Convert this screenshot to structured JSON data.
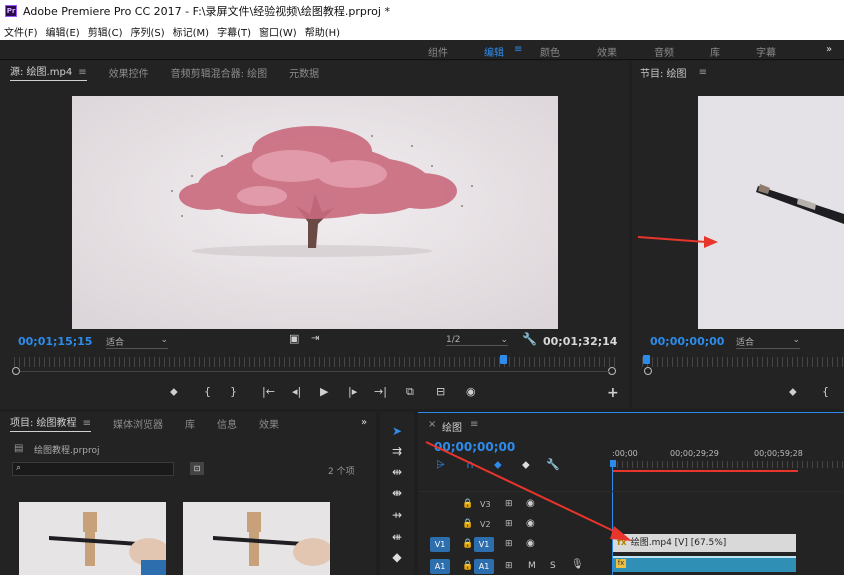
{
  "window": {
    "title": "Adobe Premiere Pro CC 2017 - F:\\录屏文件\\经验视频\\绘图教程.prproj *"
  },
  "menu": [
    "文件(F)",
    "编辑(E)",
    "剪辑(C)",
    "序列(S)",
    "标记(M)",
    "字幕(T)",
    "窗口(W)",
    "帮助(H)"
  ],
  "workspaces": {
    "items": [
      "组件",
      "编辑",
      "颜色",
      "效果",
      "音频",
      "库",
      "字幕"
    ],
    "active": "编辑",
    "more": "»"
  },
  "source_monitor": {
    "tabs": [
      "源: 绘图.mp4",
      "效果控件",
      "音频剪辑混合器: 绘图",
      "元数据"
    ],
    "timecode_in": "00;01;15;15",
    "fit": "适合",
    "resolution": "1/2",
    "timecode_out": "00;01;32;14"
  },
  "program_monitor": {
    "tab": "节目: 绘图",
    "timecode": "00;00;00;00",
    "fit": "适合"
  },
  "project_panel": {
    "tabs": [
      "项目: 绘图教程",
      "媒体浏览器",
      "库",
      "信息",
      "效果"
    ],
    "file": "绘图教程.prproj",
    "count": "2 个项",
    "more": "»"
  },
  "timeline": {
    "tab": "绘图",
    "close": "×",
    "timecode": "00;00;00;00",
    "ruler_labels": [
      ":00;00",
      "00;00;29;29",
      "00;00;59;28"
    ],
    "tracks_video": [
      "V3",
      "V2",
      "V1"
    ],
    "source_patch_v": "V1",
    "source_patch_a": "A1",
    "audio_track": "A1",
    "clip_label": "绘图.mp4 [V] [67.5%]",
    "clip_fx": "fx",
    "mute": "M",
    "solo": "S"
  },
  "colors": {
    "accent": "#2d8ceb",
    "arrow": "#e8352b",
    "clip_video": "#d9d9d9",
    "clip_audio": "#2f8fb5"
  }
}
